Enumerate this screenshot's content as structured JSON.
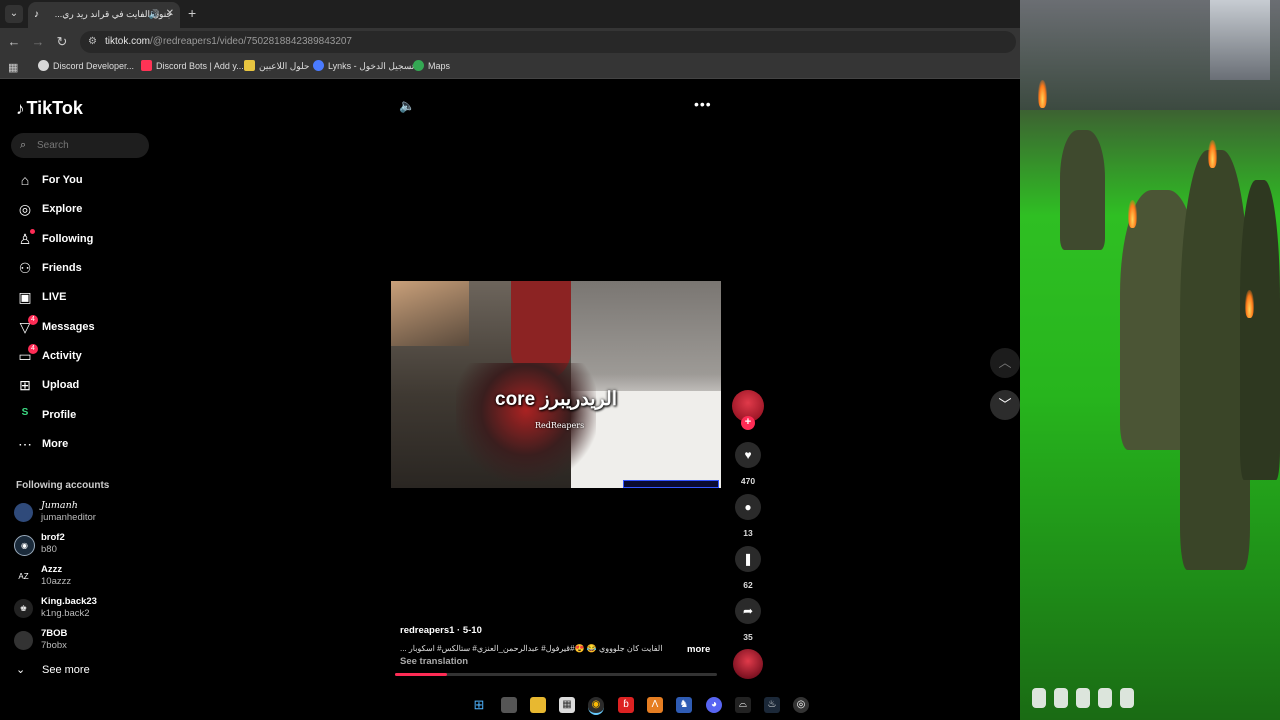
{
  "browser": {
    "tab_title": "جنون الفايت في قراند ريد ري...",
    "url_host": "tiktok.com",
    "url_path": "/@redreapers1/video/7502818842389843207",
    "bookmarks": [
      {
        "label": "Discord Developer...",
        "color": "#5865f2"
      },
      {
        "label": "Discord Bots | Add y...",
        "color": "#ff3355"
      },
      {
        "label": "حلول اللاعبين",
        "color": "#e8c540"
      },
      {
        "label": "Lynks - تسجيل الدخول",
        "color": "#4a7bff"
      },
      {
        "label": "Maps",
        "color": "#34a853"
      }
    ]
  },
  "tiktok": {
    "logo": "TikTok",
    "search_placeholder": "Search",
    "nav": [
      {
        "label": "For You",
        "icon": "home-icon"
      },
      {
        "label": "Explore",
        "icon": "compass-icon"
      },
      {
        "label": "Following",
        "icon": "user-follow-icon"
      },
      {
        "label": "Friends",
        "icon": "friends-icon"
      },
      {
        "label": "LIVE",
        "icon": "live-icon"
      },
      {
        "label": "Messages",
        "icon": "messages-icon",
        "badge": "4"
      },
      {
        "label": "Activity",
        "icon": "activity-icon",
        "badge": "4"
      },
      {
        "label": "Upload",
        "icon": "upload-icon"
      },
      {
        "label": "Profile",
        "icon": "profile-icon"
      },
      {
        "label": "More",
        "icon": "more-icon"
      }
    ],
    "following_title": "Following accounts",
    "accounts": [
      {
        "name": "Jumanh",
        "handle": "jumanheditor"
      },
      {
        "name": "brof2",
        "handle": "b80"
      },
      {
        "name": "Azzz",
        "handle": "10azzz"
      },
      {
        "name": "King.back23",
        "handle": "k1ng.back2"
      },
      {
        "name": "7BOB",
        "handle": "7bobx"
      }
    ],
    "see_more": "See more",
    "video": {
      "caption_overlay": "core الريدريبرز",
      "watermark": "RedReapers",
      "author": "redreapers1 · 5-10",
      "description": "الفايت كان جلوووي 😂 😍#قيرفول# عبدالرحمن_العنزي# ستالكس# اسكوبار ...",
      "more": "more",
      "see_translation": "See translation",
      "progress": 0.16
    },
    "actions": {
      "likes": "470",
      "comments": "13",
      "saves": "62",
      "shares": "35"
    }
  }
}
